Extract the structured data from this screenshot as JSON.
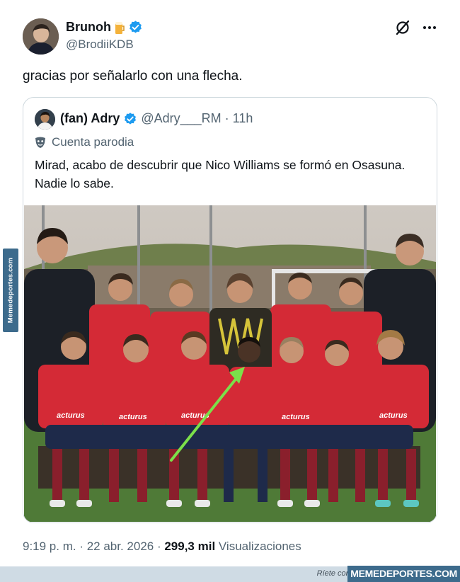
{
  "tweet": {
    "author_name": "Brunoh",
    "handle": "@BrodiiKDB",
    "text": "gracias por señalarlo con una flecha.",
    "footer": {
      "time_date": "9:19 p. m. · 22 abr. 2026 · ",
      "views_count": "299,3 mil",
      "views_label": " Visualizaciones"
    }
  },
  "quoted": {
    "author_name": "(fan) Adry",
    "handle_time": "@Adry___RM · 11h",
    "label": "Cuenta parodia",
    "text": "Mirad, acabo de descubrir que Nico Williams se formó en Osasuna. Nadie lo sabe.",
    "photo_shirt_text": "acturus"
  },
  "watermarks": {
    "side": "Memedeportes.com",
    "tagline": "Ríete con el deporte en",
    "brand": "MEMEDEPORTES.COM"
  },
  "icons": {
    "verified": "verified-badge-icon",
    "grok": "grok-icon",
    "more": "more-icon",
    "parody": "parody-mask-icon",
    "arrow": "green-arrow"
  },
  "colors": {
    "verified": "#1d9bf0",
    "kit_red": "#d42a36",
    "arrow": "#7be04a",
    "brand": "#3d6b8c"
  }
}
